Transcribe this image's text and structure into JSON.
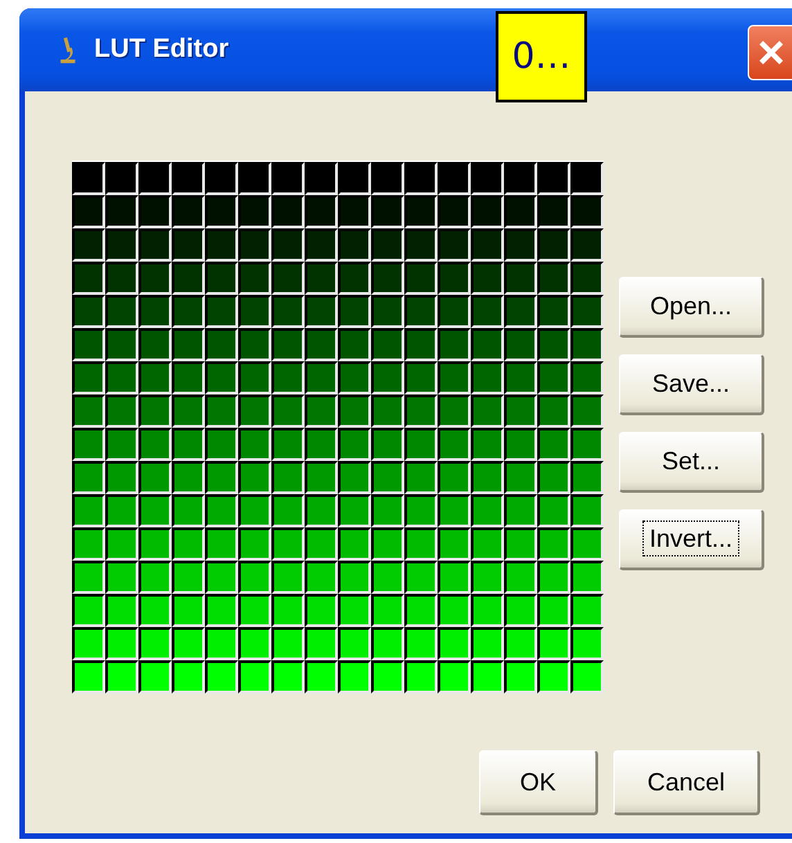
{
  "window": {
    "title": "LUT Editor",
    "badge": "0…"
  },
  "grid": {
    "rows": [
      {
        "color": "#000000"
      },
      {
        "color": "#001100"
      },
      {
        "color": "#002200"
      },
      {
        "color": "#003300"
      },
      {
        "color": "#004400"
      },
      {
        "color": "#005500"
      },
      {
        "color": "#006600"
      },
      {
        "color": "#007700"
      },
      {
        "color": "#008800"
      },
      {
        "color": "#009900"
      },
      {
        "color": "#00aa00"
      },
      {
        "color": "#00bb00"
      },
      {
        "color": "#00cc00"
      },
      {
        "color": "#00dd00"
      },
      {
        "color": "#00ee00"
      },
      {
        "color": "#00ff00"
      }
    ]
  },
  "side_buttons": [
    {
      "label": "Open...",
      "focused": false
    },
    {
      "label": "Save...",
      "focused": false
    },
    {
      "label": "Set...",
      "focused": false
    },
    {
      "label": "Invert...",
      "focused": true
    }
  ],
  "buttons": [
    {
      "label": "OK"
    },
    {
      "label": "Cancel"
    }
  ]
}
